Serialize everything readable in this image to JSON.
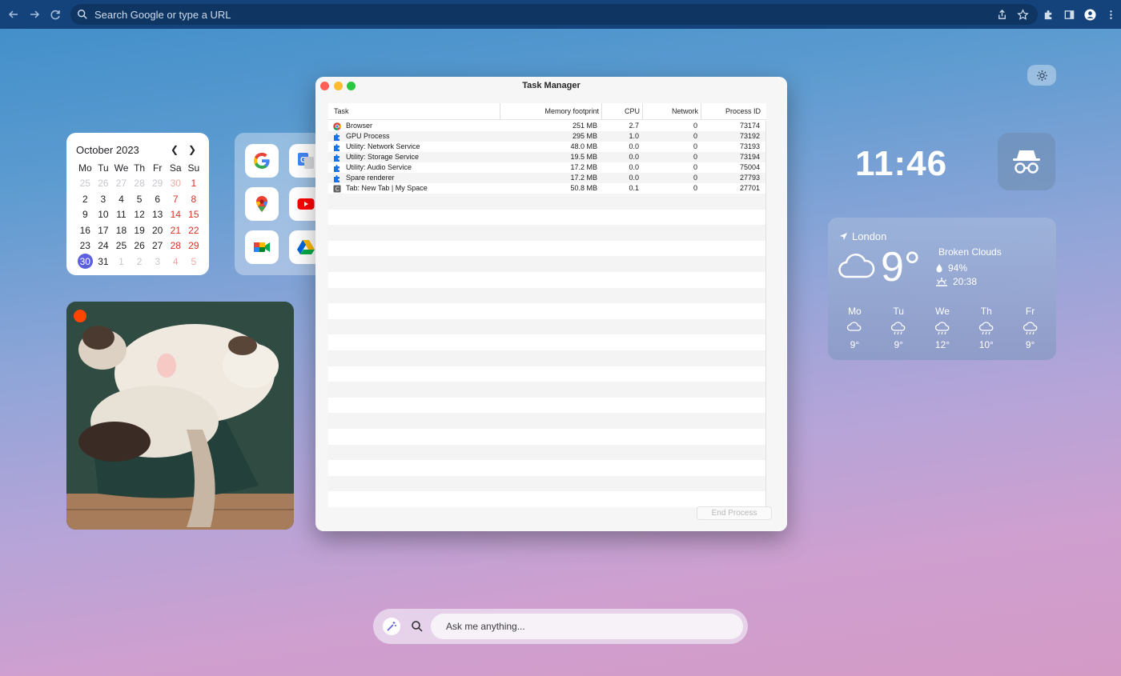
{
  "browser": {
    "omnibox_placeholder": "Search Google or type a URL"
  },
  "calendar": {
    "title": "October 2023",
    "weekdays": [
      "Mo",
      "Tu",
      "We",
      "Th",
      "Fr",
      "Sa",
      "Su"
    ],
    "weeks": [
      [
        "25",
        "26",
        "27",
        "28",
        "29",
        "30",
        "1"
      ],
      [
        "2",
        "3",
        "4",
        "5",
        "6",
        "7",
        "8"
      ],
      [
        "9",
        "10",
        "11",
        "12",
        "13",
        "14",
        "15"
      ],
      [
        "16",
        "17",
        "18",
        "19",
        "20",
        "21",
        "22"
      ],
      [
        "23",
        "24",
        "25",
        "26",
        "27",
        "28",
        "29"
      ],
      [
        "30",
        "31",
        "1",
        "2",
        "3",
        "4",
        "5"
      ]
    ],
    "today": "30"
  },
  "clock": {
    "time": "11:46"
  },
  "weather": {
    "location": "London",
    "temperature": "9°",
    "condition": "Broken Clouds",
    "humidity": "94%",
    "sunset": "20:38",
    "forecast": [
      {
        "day": "Mo",
        "temp": "9°",
        "icon": "cloud-icon"
      },
      {
        "day": "Tu",
        "temp": "9°",
        "icon": "rain-icon"
      },
      {
        "day": "We",
        "temp": "12°",
        "icon": "rain-icon"
      },
      {
        "day": "Th",
        "temp": "10°",
        "icon": "rain-icon"
      },
      {
        "day": "Fr",
        "temp": "9°",
        "icon": "rain-icon"
      }
    ]
  },
  "task_manager": {
    "title": "Task Manager",
    "columns": [
      "Task",
      "Memory footprint",
      "CPU",
      "Network",
      "Process ID"
    ],
    "rows": [
      {
        "task": "Browser",
        "memory": "251 MB",
        "cpu": "2.7",
        "network": "0",
        "pid": "73174",
        "icon": "chrome-icon"
      },
      {
        "task": "GPU Process",
        "memory": "295 MB",
        "cpu": "1.0",
        "network": "0",
        "pid": "73192",
        "icon": "puzzle-icon"
      },
      {
        "task": "Utility: Network Service",
        "memory": "48.0 MB",
        "cpu": "0.0",
        "network": "0",
        "pid": "73193",
        "icon": "puzzle-icon"
      },
      {
        "task": "Utility: Storage Service",
        "memory": "19.5 MB",
        "cpu": "0.0",
        "network": "0",
        "pid": "73194",
        "icon": "puzzle-icon"
      },
      {
        "task": "Utility: Audio Service",
        "memory": "17.2 MB",
        "cpu": "0.0",
        "network": "0",
        "pid": "75004",
        "icon": "puzzle-icon"
      },
      {
        "task": "Spare renderer",
        "memory": "17.2 MB",
        "cpu": "0.0",
        "network": "0",
        "pid": "27793",
        "icon": "puzzle-icon"
      },
      {
        "task": "Tab: New Tab | My Space",
        "memory": "50.8 MB",
        "cpu": "0.1",
        "network": "0",
        "pid": "27701",
        "icon": "tab-icon"
      }
    ],
    "tab_icon_letter": "C",
    "end_process_label": "End Process"
  },
  "ask_bar": {
    "placeholder": "Ask me anything..."
  },
  "colors": {
    "toolbar": "#14427b",
    "today_highlight": "#5b5fe0",
    "weekend": "#d93025",
    "puzzle_icon": "#1a73e8"
  }
}
